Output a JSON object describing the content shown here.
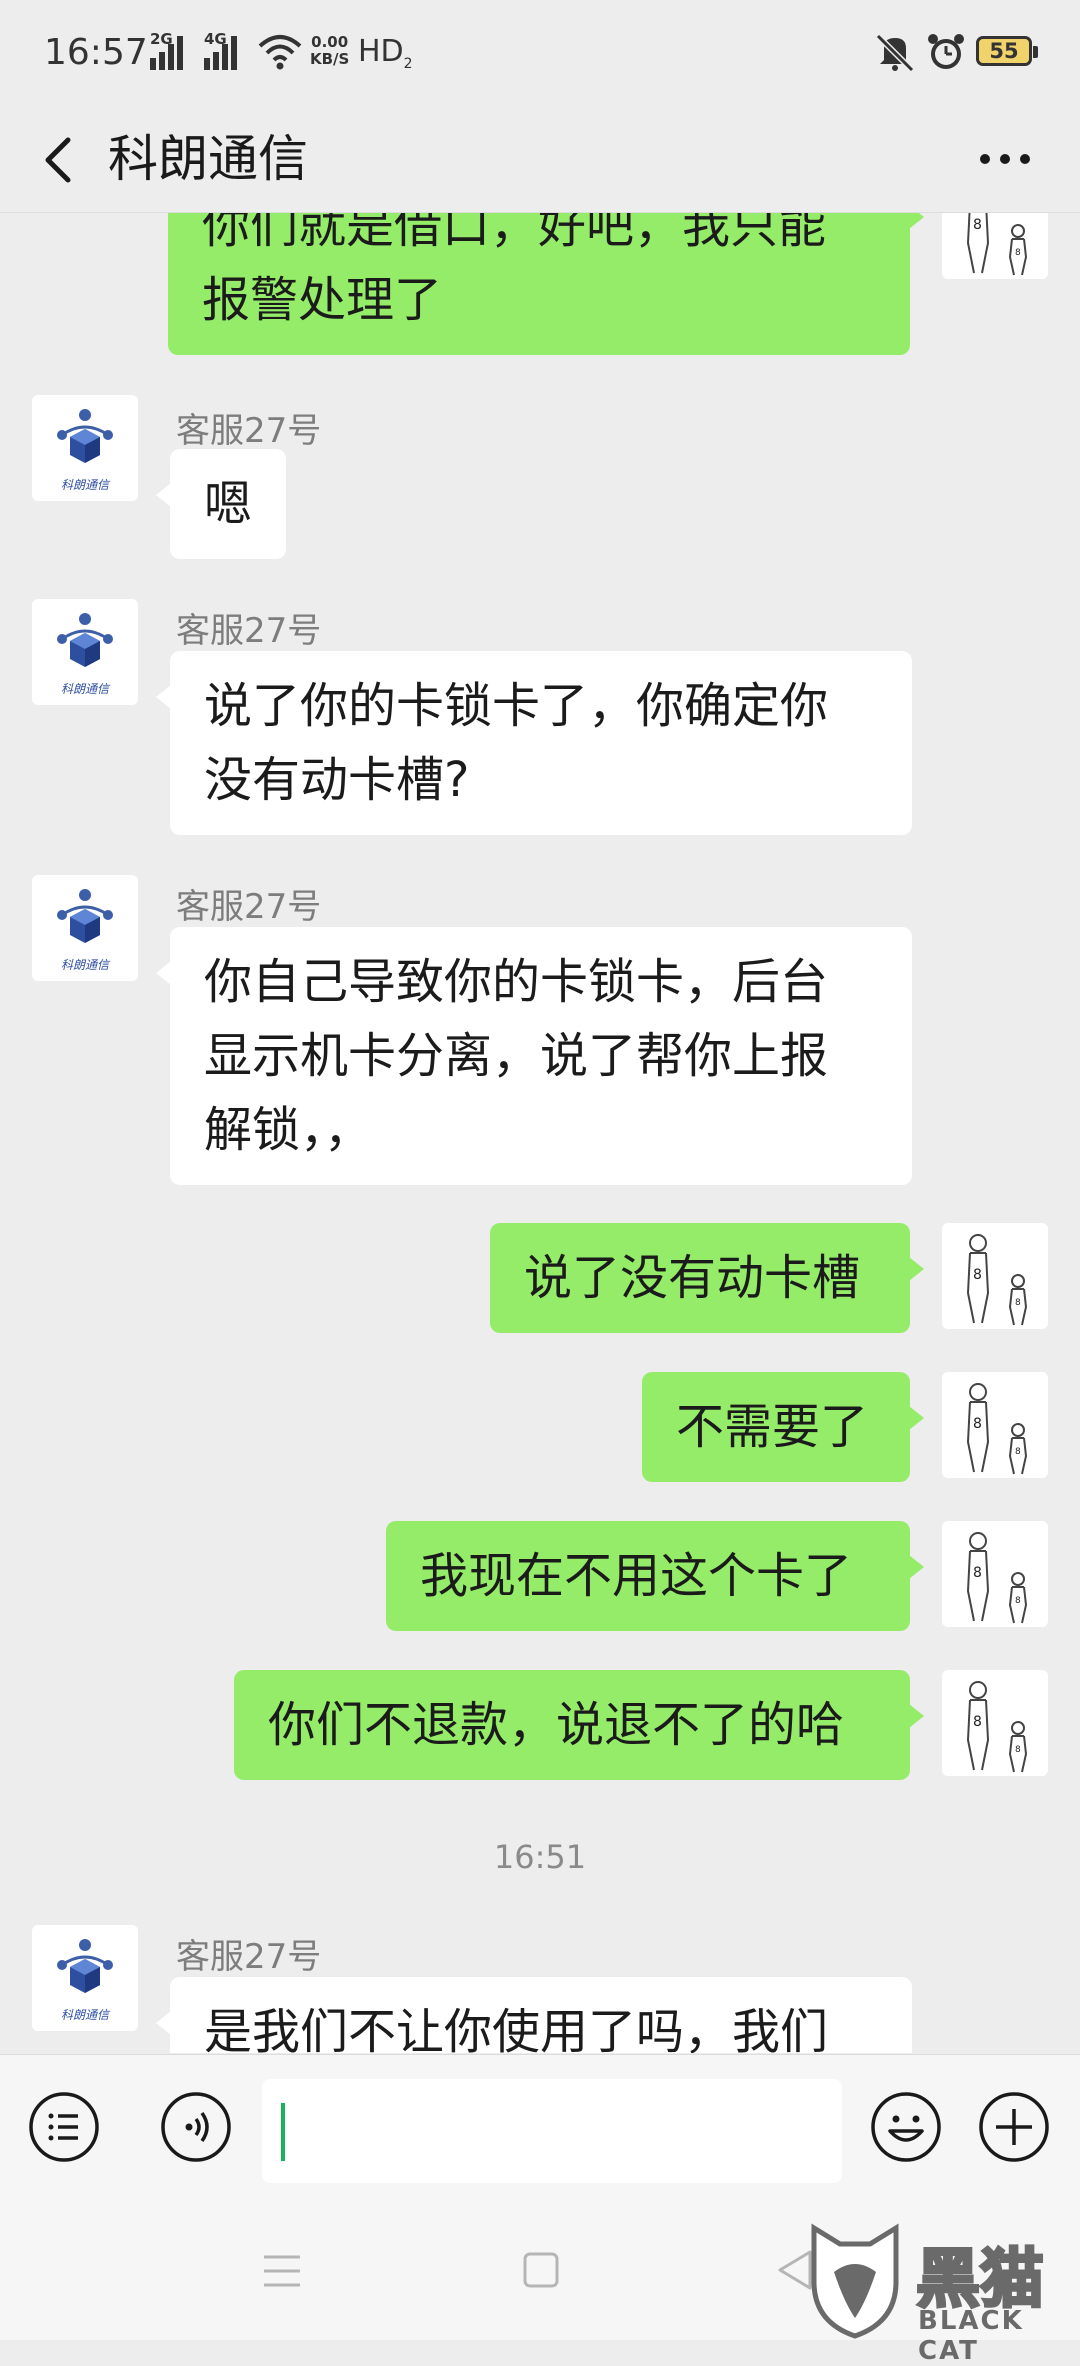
{
  "status_bar": {
    "time": "16:57",
    "signal1_gen": "2G",
    "signal2_gen": "4G",
    "net_speed_value": "0.00",
    "net_speed_unit": "KB/S",
    "hd_label": "HD",
    "hd_sub": "2",
    "battery": "55",
    "icons": [
      "signal-icon",
      "wifi-icon",
      "mute-icon",
      "alarm-icon",
      "battery-icon"
    ]
  },
  "header": {
    "title": "科朗通信",
    "back_icon": "chevron-left-icon",
    "more_icon": "ellipsis-icon"
  },
  "messages": [
    {
      "side": "right",
      "lines": [
        "你们就是借口，好吧，我只能",
        "报警处理了"
      ]
    },
    {
      "side": "left",
      "sender": "客服27号",
      "lines": [
        "嗯"
      ]
    },
    {
      "side": "left",
      "sender": "客服27号",
      "lines": [
        "说了你的卡锁卡了，你确定你",
        "没有动卡槽?"
      ]
    },
    {
      "side": "left",
      "sender": "客服27号",
      "lines": [
        "你自己导致你的卡锁卡，后台",
        "显示机卡分离，说了帮你上报",
        "解锁，，"
      ]
    },
    {
      "side": "right",
      "lines": [
        "说了没有动卡槽"
      ]
    },
    {
      "side": "right",
      "lines": [
        "不需要了"
      ]
    },
    {
      "side": "right",
      "lines": [
        "我现在不用这个卡了"
      ]
    },
    {
      "side": "right",
      "lines": [
        "你们不退款，说退不了的哈"
      ]
    },
    {
      "type": "time",
      "text": "16:51"
    },
    {
      "side": "left",
      "sender": "客服27号",
      "lines": [
        "是我们不让你使用了吗，我们"
      ]
    }
  ],
  "avatar_logo_text": "科朗通信",
  "input_bar": {
    "value": "",
    "left_icon": "list-menu-icon",
    "voice_icon": "voice-icon",
    "emoji_icon": "emoji-icon",
    "plus_icon": "plus-icon"
  },
  "nav_bar": {
    "icons": [
      "menu-nav-icon",
      "home-nav-icon",
      "back-nav-icon"
    ]
  },
  "watermark": {
    "cn": "黑猫",
    "en": "BLACK CAT"
  },
  "colors": {
    "background": "#ededed",
    "my_bubble": "#95ec69",
    "their_bubble": "#ffffff",
    "caret": "#19b35b"
  }
}
